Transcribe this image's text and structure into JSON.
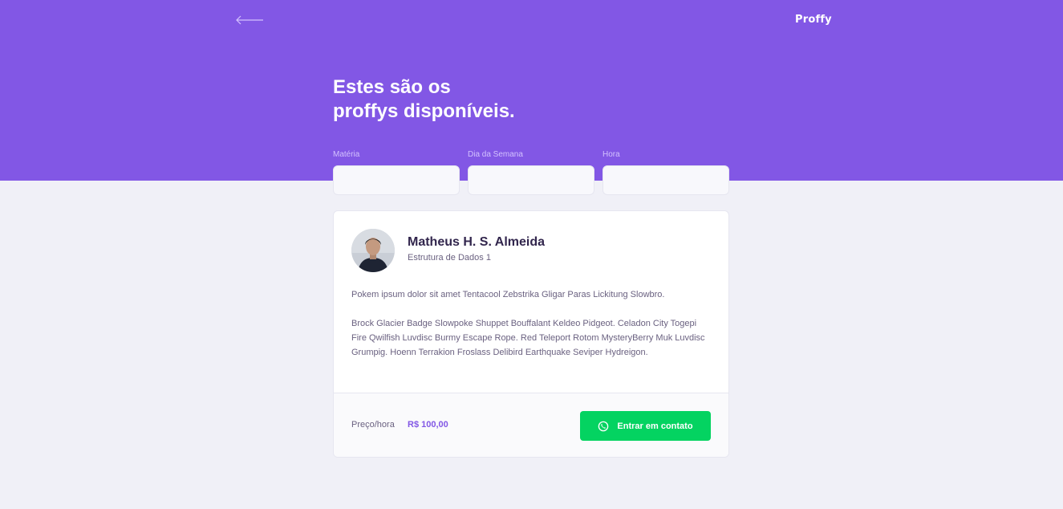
{
  "header": {
    "logo": "Proffy",
    "title_line1": "Estes são os",
    "title_line2": "proffys disponíveis.",
    "back_icon": "arrow-left-icon"
  },
  "filters": {
    "subject_label": "Matéria",
    "subject_value": "",
    "weekday_label": "Dia da Semana",
    "weekday_value": "",
    "time_label": "Hora",
    "time_value": ""
  },
  "teacher": {
    "name": "Matheus H. S. Almeida",
    "subject": "Estrutura de Dados 1",
    "bio_paragraph1": "Pokem ipsum dolor sit amet Tentacool Zebstrika Gligar Paras Lickitung Slowbro.",
    "bio_paragraph2": "Brock Glacier Badge Slowpoke Shuppet Bouffalant Keldeo Pidgeot. Celadon City Togepi Fire Qwilfish Luvdisc Burmy Escape Rope. Red Teleport Rotom MysteryBerry Muk Luvdisc Grumpig. Hoenn Terrakion Froslass Delibird Earthquake Seviper Hydreigon.",
    "price_label": "Preço/hora",
    "price_value": "R$ 100,00",
    "contact_label": "Entrar em contato",
    "contact_icon": "whatsapp-icon"
  },
  "colors": {
    "primary": "#8257E5",
    "background": "#F0F0F7",
    "contact_button": "#04D361",
    "title_text": "#32264D",
    "body_text": "#6A6180"
  }
}
